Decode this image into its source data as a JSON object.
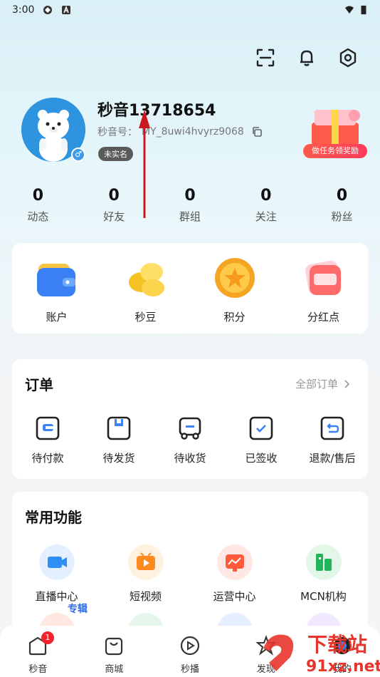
{
  "status": {
    "time": "3:00"
  },
  "profile": {
    "username": "秒音13718654",
    "uid_label": "秒音号：",
    "uid_value": "MY_8uwi4hvyrz9068",
    "realname_badge": "未实名",
    "reward_label": "做任务领奖励"
  },
  "stats": [
    {
      "value": "0",
      "label": "动态"
    },
    {
      "value": "0",
      "label": "好友"
    },
    {
      "value": "0",
      "label": "群组"
    },
    {
      "value": "0",
      "label": "关注"
    },
    {
      "value": "0",
      "label": "粉丝"
    }
  ],
  "assets": [
    {
      "label": "账户",
      "icon": "wallet-icon"
    },
    {
      "label": "秒豆",
      "icon": "beans-icon"
    },
    {
      "label": "积分",
      "icon": "star-coin-icon"
    },
    {
      "label": "分红点",
      "icon": "dividend-icon"
    }
  ],
  "orders": {
    "title": "订单",
    "all_label": "全部订单",
    "items": [
      {
        "label": "待付款",
        "icon": "pending-payment-icon"
      },
      {
        "label": "待发货",
        "icon": "pending-ship-icon"
      },
      {
        "label": "待收货",
        "icon": "pending-receive-icon"
      },
      {
        "label": "已签收",
        "icon": "signed-icon"
      },
      {
        "label": "退款/售后",
        "icon": "refund-icon"
      }
    ]
  },
  "functions": {
    "title": "常用功能",
    "items": [
      {
        "label": "直播中心",
        "icon": "live-center-icon"
      },
      {
        "label": "短视频",
        "icon": "short-video-icon"
      },
      {
        "label": "运营中心",
        "icon": "operation-center-icon"
      },
      {
        "label": "MCN机构",
        "icon": "mcn-icon"
      }
    ],
    "partial_label": "专辑"
  },
  "tabbar": [
    {
      "label": "秒音",
      "icon": "home-tab-icon",
      "badge": "1"
    },
    {
      "label": "商城",
      "icon": "mall-tab-icon"
    },
    {
      "label": "秒播",
      "icon": "play-tab-icon"
    },
    {
      "label": "发现",
      "icon": "discover-tab-icon"
    },
    {
      "label": "我的",
      "icon": "me-tab-icon"
    }
  ],
  "watermark": {
    "line1": "下载站",
    "line2": "91xz.net"
  },
  "colors": {
    "accent": "#2d6cdf",
    "reward": "#ff3b5c",
    "badge": "#f3232c"
  }
}
